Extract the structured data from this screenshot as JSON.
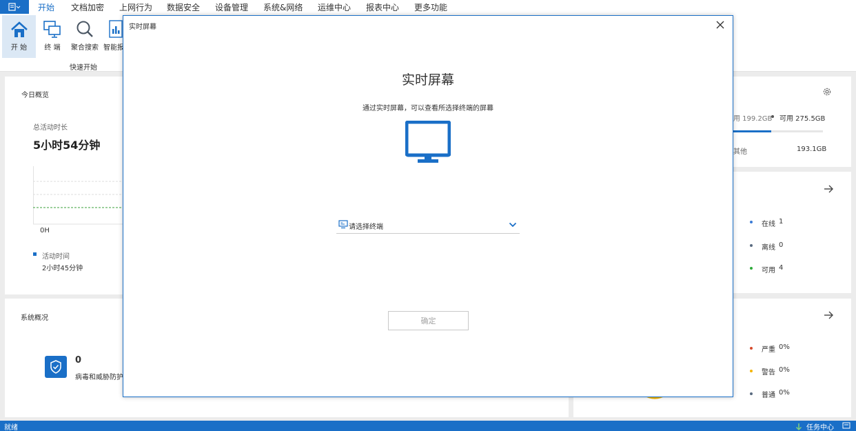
{
  "menu": {
    "tabs": [
      "开始",
      "文档加密",
      "上网行为",
      "数据安全",
      "设备管理",
      "系统&网络",
      "运维中心",
      "报表中心",
      "更多功能"
    ],
    "active_index": 0
  },
  "ribbon": {
    "buttons": [
      {
        "label": "开 始",
        "icon": "home-icon"
      },
      {
        "label": "终 端",
        "icon": "terminal-icon"
      },
      {
        "label": "聚合搜索",
        "icon": "search-icon"
      },
      {
        "label": "智能报",
        "icon": "report-icon"
      }
    ],
    "group_label": "快速开始"
  },
  "today": {
    "title": "今日概览",
    "total_label": "总活动时长",
    "total_value": "5小时54分钟",
    "axis_label": "0H",
    "legend_label": "活动时间",
    "legend_value": "2小时45分钟"
  },
  "system": {
    "title": "系统概况",
    "virus_count": "0",
    "virus_label": "病毒和威胁防护"
  },
  "disk": {
    "used_text": "用 199.2GB",
    "avail_text": "可用 275.5GB",
    "other_label": "其他",
    "other_value": "193.1GB",
    "used_fraction": 0.42
  },
  "terminals": {
    "online": "在线",
    "online_count": "1",
    "offline": "离线",
    "offline_count": "0",
    "available": "可用",
    "available_count": "4"
  },
  "alerts": {
    "severe": "严重",
    "severe_pct": "0%",
    "warning": "警告",
    "warning_pct": "0%",
    "normal": "普通",
    "normal_pct": "0%"
  },
  "modal": {
    "window_title": "实时屏幕",
    "heading": "实时屏幕",
    "description": "通过实时屏幕，可以查看所选择终端的屏幕",
    "select_placeholder": "请选择终端",
    "confirm_label": "确定"
  },
  "statusbar": {
    "left": "就绪",
    "task_center": "任务中心"
  },
  "colors": {
    "accent": "#1a6fc7",
    "online": "#3a7bd5",
    "offline": "#5a6b80",
    "available": "#2eaa3a",
    "severe": "#d64a2b",
    "warning": "#f4b400",
    "normal": "#5a6b80"
  }
}
